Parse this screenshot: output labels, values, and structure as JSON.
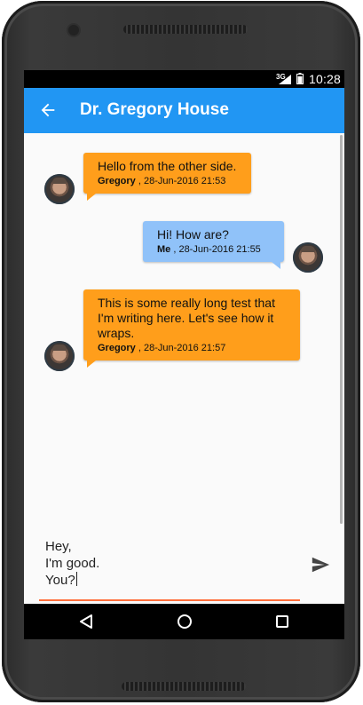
{
  "status_bar": {
    "network": "3G",
    "time": "10:28"
  },
  "app_bar": {
    "title": "Dr. Gregory House",
    "back_icon": "arrow-left-icon"
  },
  "messages": [
    {
      "side": "them",
      "text": "Hello from the other side.",
      "sender": "Gregory",
      "timestamp": " , 28-Jun-2016 21:53"
    },
    {
      "side": "me",
      "text": "Hi! How are?",
      "sender": "Me",
      "timestamp": " , 28-Jun-2016 21:55"
    },
    {
      "side": "them",
      "text": "This is some really long test that I'm writing here. Let's see how it wraps.",
      "sender": "Gregory",
      "timestamp": " , 28-Jun-2016 21:57"
    }
  ],
  "composer": {
    "value": "Hey,\nI'm good.\nYou?",
    "send_icon": "send-icon"
  },
  "nav_bar": {
    "back_icon": "triangle-back-icon",
    "home_icon": "circle-home-icon",
    "recents_icon": "square-recents-icon"
  },
  "colors": {
    "app_bar": "#2196f3",
    "bubble_them": "#ff9e1b",
    "bubble_me": "#90c2f9",
    "accent_underline": "#ff6f3c"
  }
}
